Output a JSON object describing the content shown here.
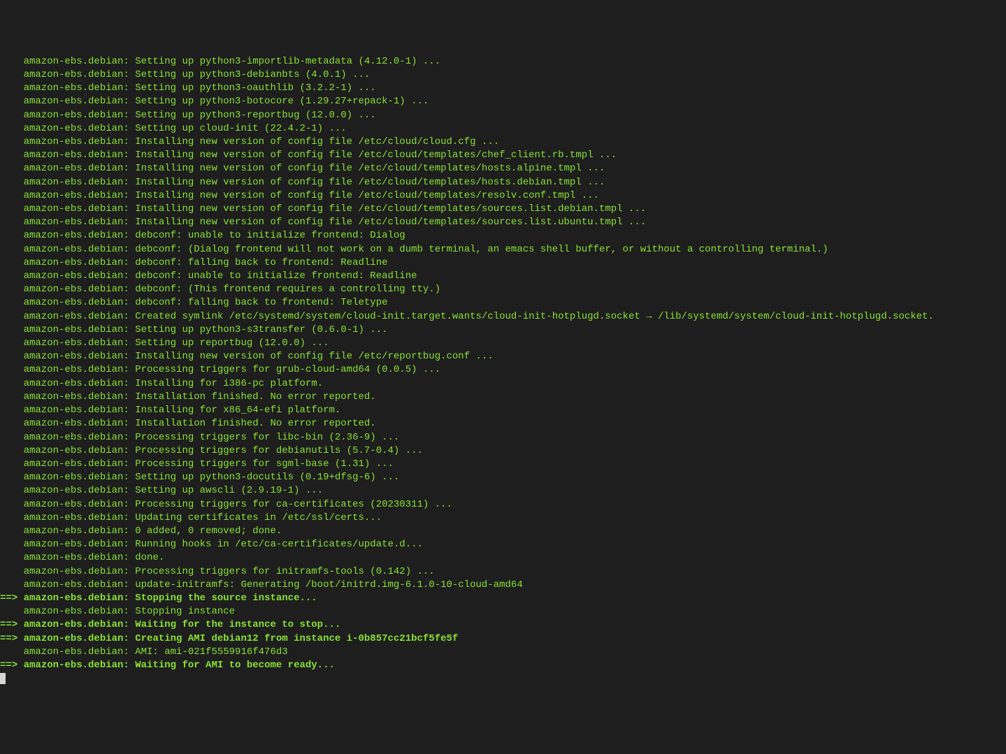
{
  "prefix": "    amazon-ebs.debian: ",
  "arrow_prefix": "==> amazon-ebs.debian: ",
  "lines": [
    {
      "type": "normal",
      "text": "Setting up python3-importlib-metadata (4.12.0-1) ..."
    },
    {
      "type": "normal",
      "text": "Setting up python3-debianbts (4.0.1) ..."
    },
    {
      "type": "normal",
      "text": "Setting up python3-oauthlib (3.2.2-1) ..."
    },
    {
      "type": "normal",
      "text": "Setting up python3-botocore (1.29.27+repack-1) ..."
    },
    {
      "type": "normal",
      "text": "Setting up python3-reportbug (12.0.0) ..."
    },
    {
      "type": "normal",
      "text": "Setting up cloud-init (22.4.2-1) ..."
    },
    {
      "type": "normal",
      "text": "Installing new version of config file /etc/cloud/cloud.cfg ..."
    },
    {
      "type": "normal",
      "text": "Installing new version of config file /etc/cloud/templates/chef_client.rb.tmpl ..."
    },
    {
      "type": "normal",
      "text": "Installing new version of config file /etc/cloud/templates/hosts.alpine.tmpl ..."
    },
    {
      "type": "normal",
      "text": "Installing new version of config file /etc/cloud/templates/hosts.debian.tmpl ..."
    },
    {
      "type": "normal",
      "text": "Installing new version of config file /etc/cloud/templates/resolv.conf.tmpl ..."
    },
    {
      "type": "normal",
      "text": "Installing new version of config file /etc/cloud/templates/sources.list.debian.tmpl ..."
    },
    {
      "type": "normal",
      "text": "Installing new version of config file /etc/cloud/templates/sources.list.ubuntu.tmpl ..."
    },
    {
      "type": "normal",
      "text": "debconf: unable to initialize frontend: Dialog"
    },
    {
      "type": "normal",
      "text": "debconf: (Dialog frontend will not work on a dumb terminal, an emacs shell buffer, or without a controlling terminal.)"
    },
    {
      "type": "normal",
      "text": "debconf: falling back to frontend: Readline"
    },
    {
      "type": "normal",
      "text": "debconf: unable to initialize frontend: Readline"
    },
    {
      "type": "normal",
      "text": "debconf: (This frontend requires a controlling tty.)"
    },
    {
      "type": "normal",
      "text": "debconf: falling back to frontend: Teletype"
    },
    {
      "type": "normal",
      "text": "Created symlink /etc/systemd/system/cloud-init.target.wants/cloud-init-hotplugd.socket → /lib/systemd/system/cloud-init-hotplugd.socket."
    },
    {
      "type": "normal",
      "text": "Setting up python3-s3transfer (0.6.0-1) ..."
    },
    {
      "type": "normal",
      "text": "Setting up reportbug (12.0.0) ..."
    },
    {
      "type": "normal",
      "text": "Installing new version of config file /etc/reportbug.conf ..."
    },
    {
      "type": "normal",
      "text": "Processing triggers for grub-cloud-amd64 (0.0.5) ..."
    },
    {
      "type": "normal",
      "text": "Installing for i386-pc platform."
    },
    {
      "type": "normal",
      "text": "Installation finished. No error reported."
    },
    {
      "type": "normal",
      "text": "Installing for x86_64-efi platform."
    },
    {
      "type": "normal",
      "text": "Installation finished. No error reported."
    },
    {
      "type": "normal",
      "text": "Processing triggers for libc-bin (2.36-9) ..."
    },
    {
      "type": "normal",
      "text": "Processing triggers for debianutils (5.7-0.4) ..."
    },
    {
      "type": "normal",
      "text": "Processing triggers for sgml-base (1.31) ..."
    },
    {
      "type": "normal",
      "text": "Setting up python3-docutils (0.19+dfsg-6) ..."
    },
    {
      "type": "normal",
      "text": "Setting up awscli (2.9.19-1) ..."
    },
    {
      "type": "normal",
      "text": "Processing triggers for ca-certificates (20230311) ..."
    },
    {
      "type": "normal",
      "text": "Updating certificates in /etc/ssl/certs..."
    },
    {
      "type": "normal",
      "text": "0 added, 0 removed; done."
    },
    {
      "type": "normal",
      "text": "Running hooks in /etc/ca-certificates/update.d..."
    },
    {
      "type": "normal",
      "text": "done."
    },
    {
      "type": "normal",
      "text": "Processing triggers for initramfs-tools (0.142) ..."
    },
    {
      "type": "normal",
      "text": "update-initramfs: Generating /boot/initrd.img-6.1.0-10-cloud-amd64"
    },
    {
      "type": "arrow",
      "text": "Stopping the source instance..."
    },
    {
      "type": "normal",
      "text": "Stopping instance"
    },
    {
      "type": "arrow",
      "text": "Waiting for the instance to stop..."
    },
    {
      "type": "arrow",
      "text": "Creating AMI debian12 from instance i-0b857cc21bcf5fe5f"
    },
    {
      "type": "normal",
      "text": "AMI: ami-021f5559916f476d3"
    },
    {
      "type": "arrow",
      "text": "Waiting for AMI to become ready..."
    }
  ]
}
